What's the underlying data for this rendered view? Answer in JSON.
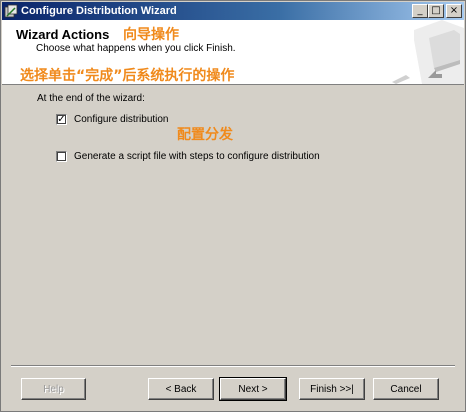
{
  "window": {
    "title": "Configure Distribution Wizard",
    "buttons": {
      "minimize": "_",
      "maximize": "□",
      "close": "×"
    }
  },
  "header": {
    "title": "Wizard Actions",
    "subtitle": "Choose what happens when you click Finish.",
    "annotation_title": "向导操作",
    "annotation_subtitle": "选择单击“完成”后系统执行的操作"
  },
  "content": {
    "label": "At the end of the wizard:",
    "options": [
      {
        "label": "Configure distribution",
        "checked": true,
        "annotation": "配置分发"
      },
      {
        "label": "Generate a script file with steps to configure distribution",
        "checked": false
      }
    ]
  },
  "buttons": {
    "help": "Help",
    "back": "< Back",
    "next": "Next >",
    "finish": "Finish >>|",
    "cancel": "Cancel"
  },
  "colors": {
    "annotation": "#f08a1c",
    "titlebar_start": "#0a246a",
    "titlebar_end": "#a6caf0",
    "dialog_bg": "#d4d0c8"
  }
}
